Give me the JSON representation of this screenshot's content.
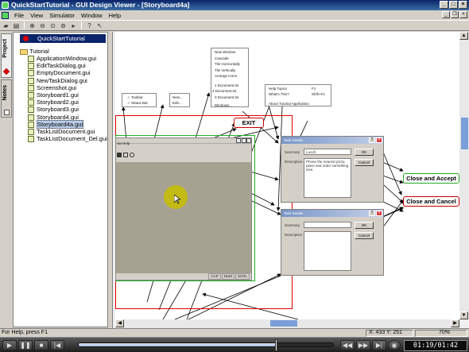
{
  "window": {
    "title": "QuickStartTutorial - GUI Design Viewer - [Storyboard4a]"
  },
  "menu": [
    "File",
    "View",
    "Simulator",
    "Window",
    "Help"
  ],
  "toolbar": [
    "open-icon",
    "print-icon",
    "zoom-in-icon",
    "zoom-out-icon",
    "zoom-100-icon",
    "zoom-fit-icon",
    "play-icon",
    "help-icon",
    "context-help-icon"
  ],
  "tabs": {
    "project": "Project",
    "notes": "Notes"
  },
  "tree": {
    "root": "QuickStartTutorial",
    "folder": "Tutorial",
    "files": [
      "ApplicationWindow.gui",
      "EditTaskDialog.gui",
      "EmptyDocument.gui",
      "NewTaskDialog.gui",
      "Screenshot.gui",
      "Storyboard1.gui",
      "Storyboard2.gui",
      "Storyboard3.gui",
      "Storyboard4.gui",
      "Storyboard4a.gui",
      "TaskListDocument.gui",
      "TaskListDocument_Del.gui"
    ],
    "selected_index": 9
  },
  "diagram": {
    "window_menu": [
      "New Window",
      "Cascade",
      "Tile Horizontally",
      "Tile Vertically",
      "Arrange Icons",
      "1 Document.txt",
      "2 Document.txt",
      "3 Document.txt",
      "Windows..."
    ],
    "help_menu": [
      {
        "label": "Help Topics",
        "key": "F1"
      },
      {
        "label": "What's This?",
        "key": "Shift+F1"
      },
      {
        "label": "About Tutorial Application",
        "key": ""
      }
    ],
    "view_menu": [
      "Toolbar",
      "Status Bar"
    ],
    "file_menu": [
      "New...",
      "Edit..."
    ],
    "exit_label": "EXIT",
    "accept_label": "Close and Accept",
    "cancel_label": "Close and Cancel",
    "dialog1": {
      "title": "Task Details",
      "summary_label": "Summary",
      "summary_value": "Lunch",
      "description_label": "Description",
      "description_value": "Phone the nearest pizza place and order something nice.",
      "ok": "OK",
      "cancel": "Cancel"
    },
    "dialog2": {
      "title": "Task Details",
      "summary_label": "Summary",
      "description_label": "Description",
      "ok": "OK",
      "cancel": "Cancel"
    },
    "app_menu_fragment": "ow Help",
    "app_status": [
      "CAP",
      "NUM",
      "SCRL"
    ]
  },
  "status": {
    "left": "For Help, press F1",
    "coords": "X: 433  Y: 251",
    "zoom": "70%"
  },
  "player": {
    "time": "01:19/01:42",
    "progress": 0.774
  },
  "colors": {
    "titlebar": "#0a246a",
    "exit_border": "#cc0000",
    "accept_border": "#22aa22",
    "red_frame": "#e00000",
    "green_frame": "#20b020"
  }
}
